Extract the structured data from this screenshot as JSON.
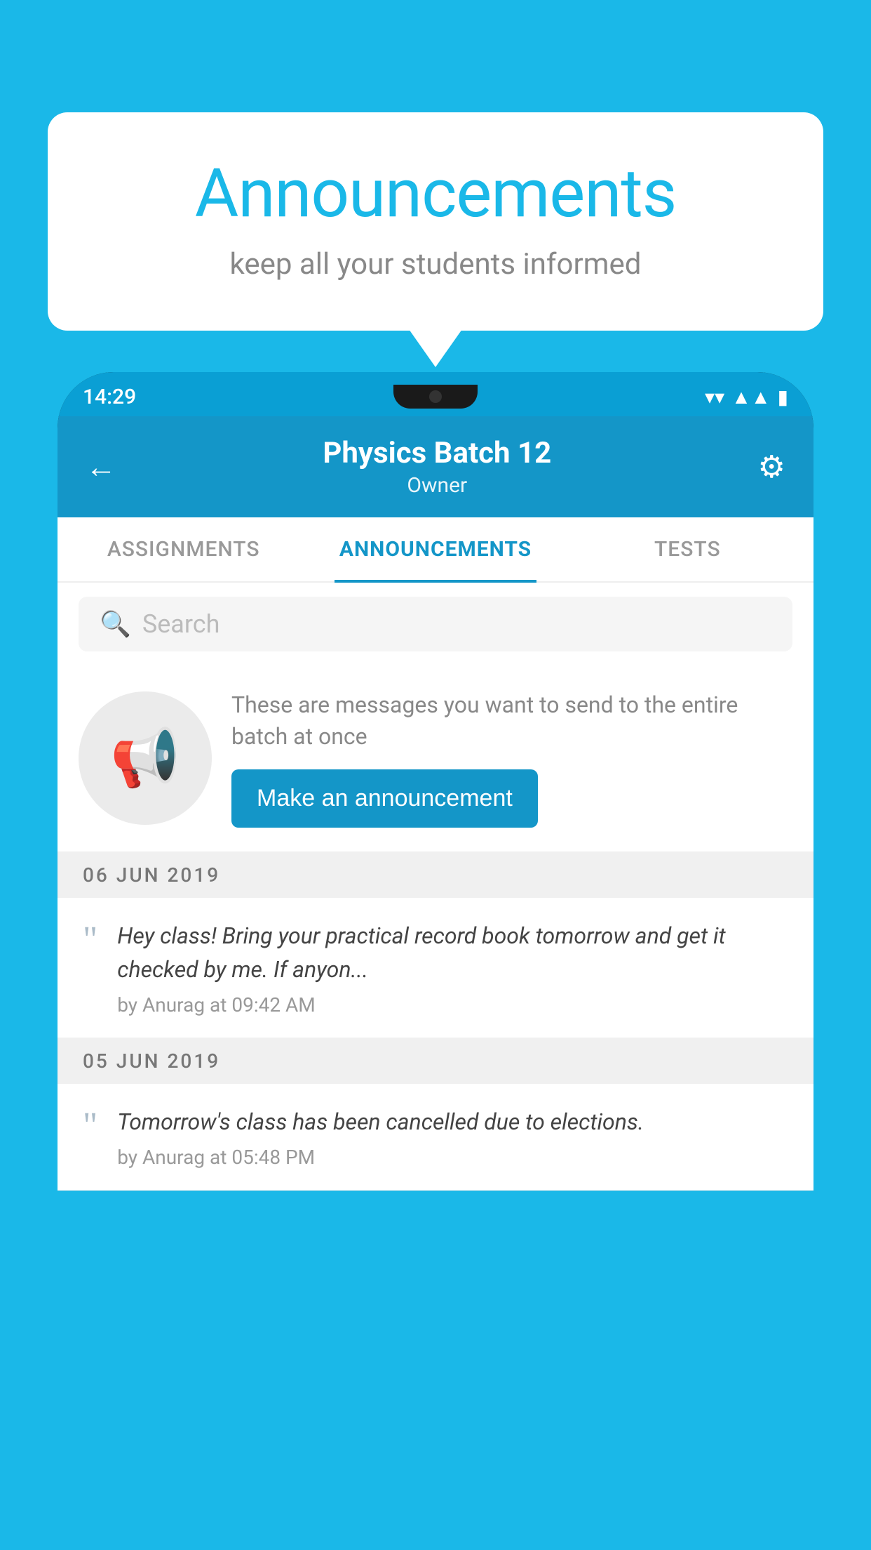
{
  "background_color": "#1ab8e8",
  "speech_bubble": {
    "title": "Announcements",
    "subtitle": "keep all your students informed"
  },
  "phone": {
    "status_bar": {
      "time": "14:29"
    },
    "header": {
      "title": "Physics Batch 12",
      "subtitle": "Owner",
      "back_label": "←"
    },
    "tabs": [
      {
        "label": "ASSIGNMENTS",
        "active": false
      },
      {
        "label": "ANNOUNCEMENTS",
        "active": true
      },
      {
        "label": "TESTS",
        "active": false
      }
    ],
    "search": {
      "placeholder": "Search"
    },
    "promo": {
      "description": "These are messages you want to send to the entire batch at once",
      "button_label": "Make an announcement"
    },
    "announcements": [
      {
        "date": "06  JUN  2019",
        "text": "Hey class! Bring your practical record book tomorrow and get it checked by me. If anyon...",
        "meta": "by Anurag at 09:42 AM"
      },
      {
        "date": "05  JUN  2019",
        "text": "Tomorrow's class has been cancelled due to elections.",
        "meta": "by Anurag at 05:48 PM"
      }
    ]
  }
}
